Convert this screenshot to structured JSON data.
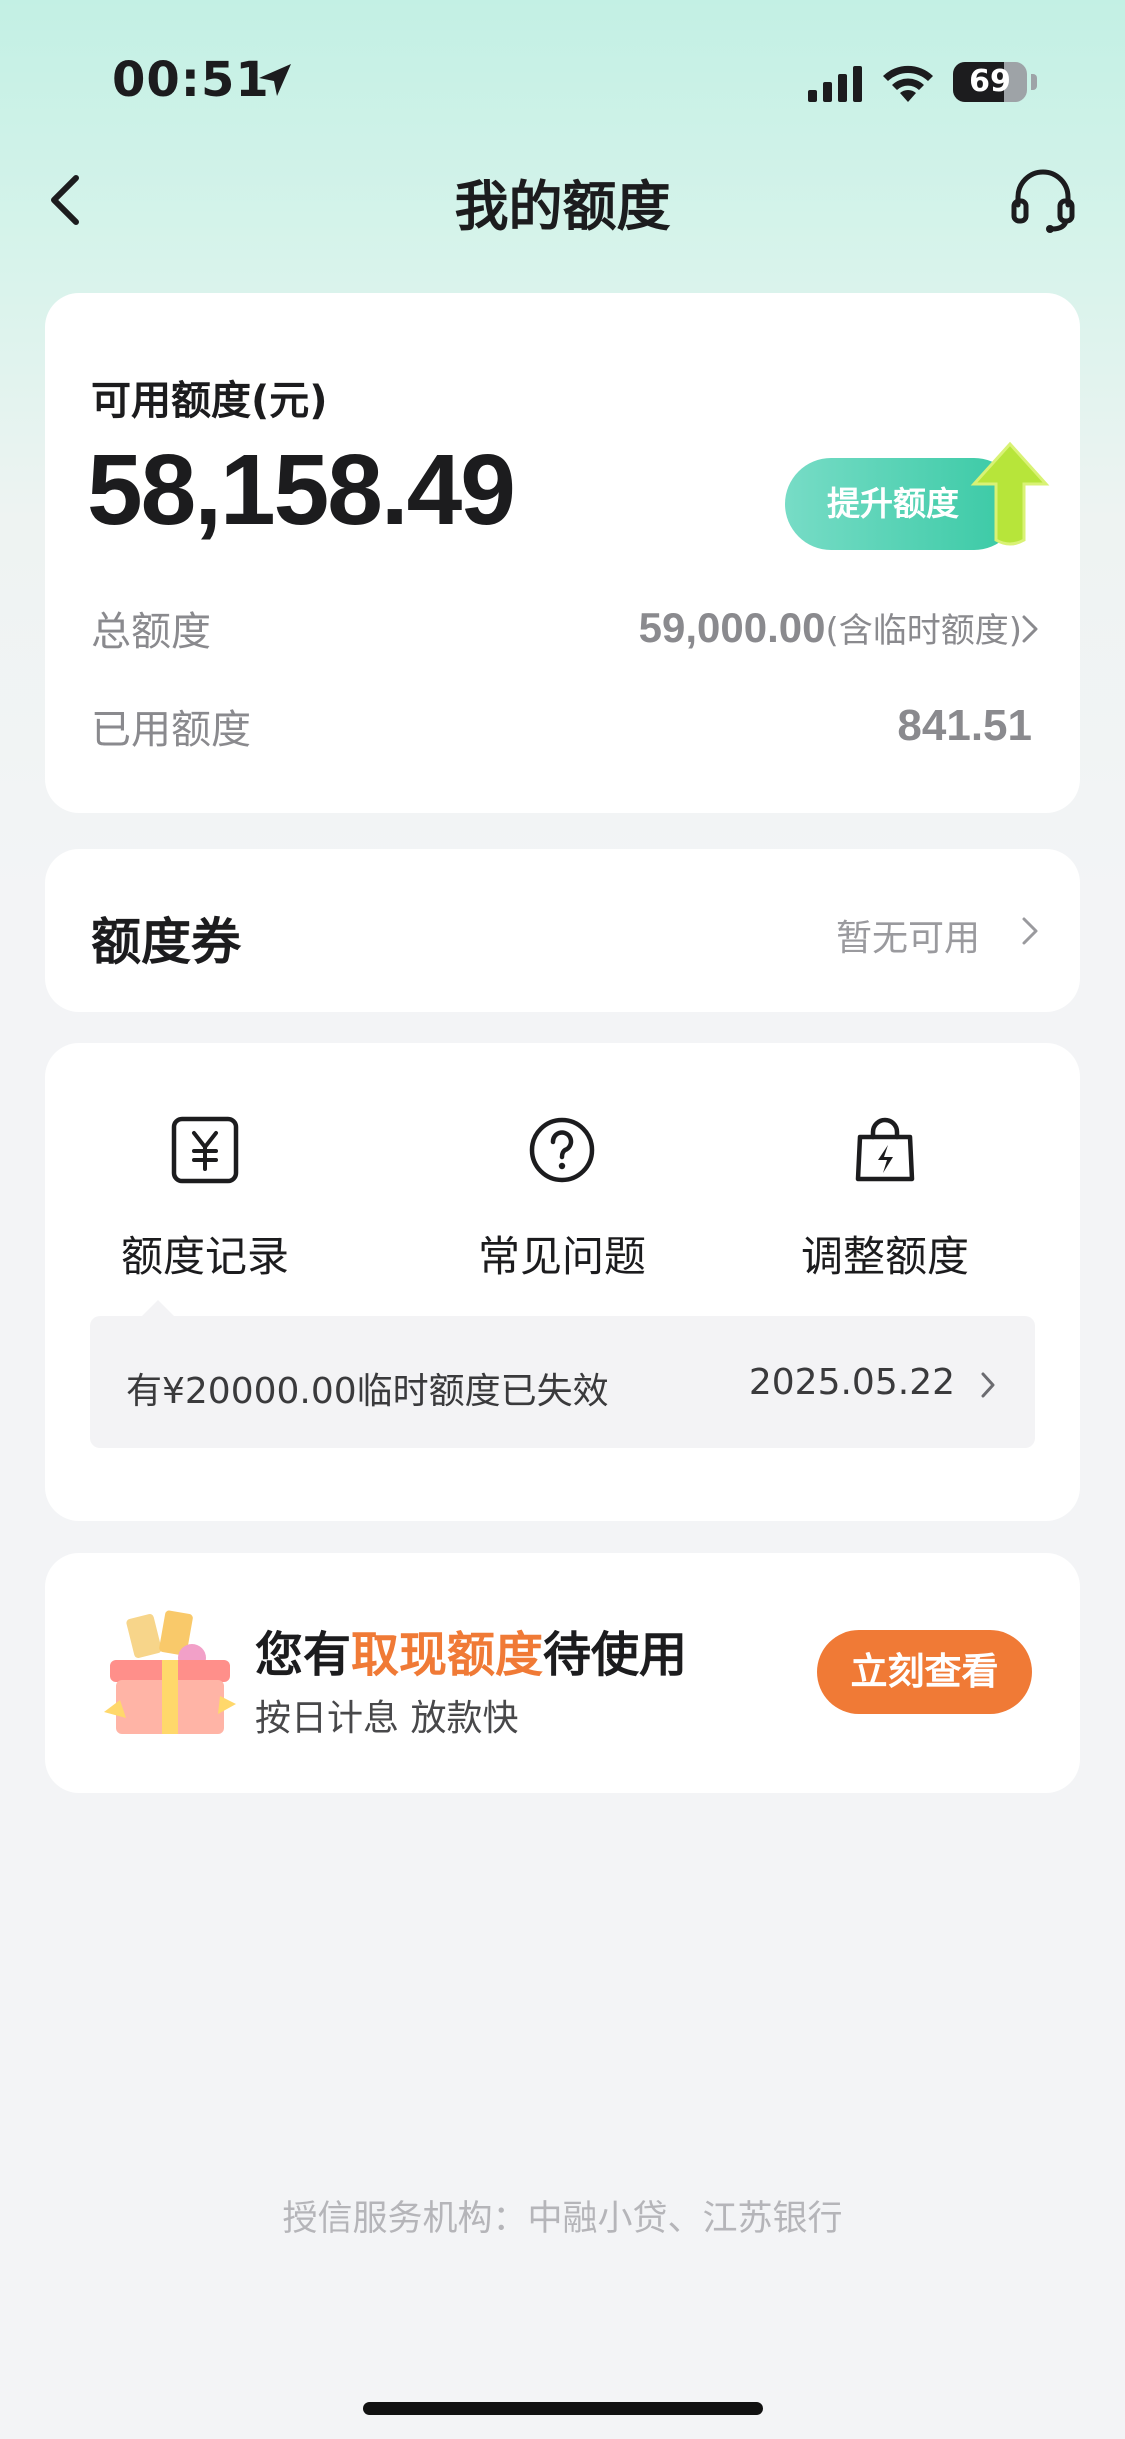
{
  "status_bar": {
    "time": "00:51",
    "battery": "69",
    "battery_level": 0.69
  },
  "nav": {
    "title": "我的额度",
    "back_icon": "chevron-left-icon",
    "service_icon": "headset-icon"
  },
  "quota": {
    "available_label": "可用额度(元)",
    "available_amount": "58,158.49",
    "boost_button": "提升额度",
    "total_label": "总额度",
    "total_value": "59,000.00",
    "total_note": "(含临时额度)",
    "used_label": "已用额度",
    "used_value": "841.51"
  },
  "coupon": {
    "label": "额度券",
    "status": "暂无可用"
  },
  "tools": [
    {
      "label": "额度记录",
      "icon": "yuan-record-icon"
    },
    {
      "label": "常见问题",
      "icon": "question-icon"
    },
    {
      "label": "调整额度",
      "icon": "bag-lightning-icon"
    }
  ],
  "notice": {
    "text": "有¥20000.00临时额度已失效",
    "date": "2025.05.22"
  },
  "promo": {
    "title_prefix": "您有",
    "title_highlight": "取现额度",
    "title_suffix": "待使用",
    "subtitle": "按日计息 放款快",
    "button": "立刻查看"
  },
  "footer": "授信服务机构：中融小贷、江苏银行",
  "colors": {
    "accent_green": "#38c9a4",
    "accent_orange": "#f07a36"
  }
}
